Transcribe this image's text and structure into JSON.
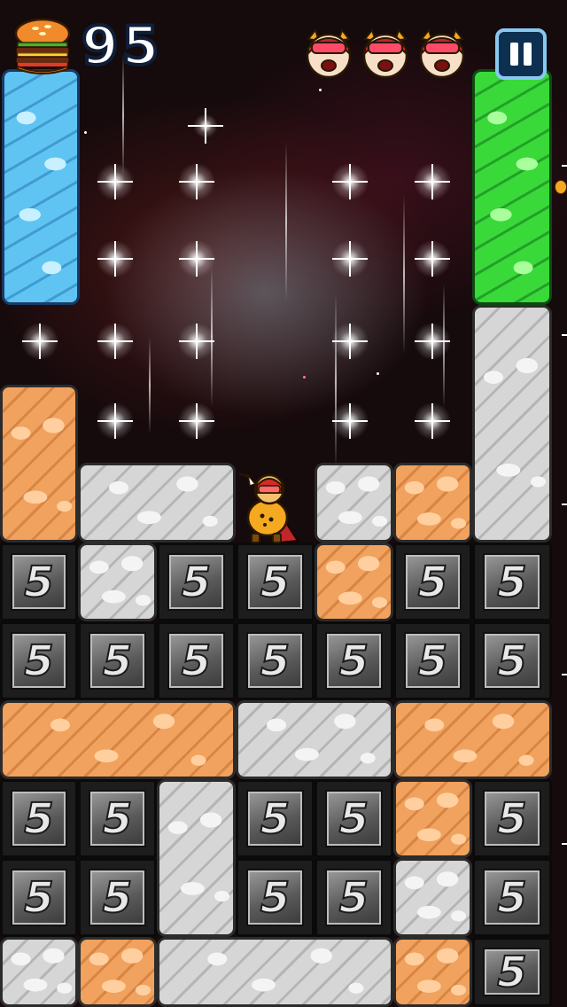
{
  "hud": {
    "score": "95",
    "lives_icon": "hero-face-icon",
    "lives_count": 3,
    "pause_icon": "pause-icon",
    "burger_icon": "burger-icon"
  },
  "colors": {
    "score_outline": "#0f1e3a",
    "pause_border": "#89c8f0",
    "pause_fill": "#0e3050",
    "stone_gray": "#d6d6d6",
    "stone_orange": "#f0a25e",
    "stone_blue": "#5fc4f2",
    "stone_green": "#39d93a",
    "metal_block": "#6a6a6a"
  },
  "board": {
    "metal_label": "5",
    "cell_size": 89,
    "columns": 7
  }
}
